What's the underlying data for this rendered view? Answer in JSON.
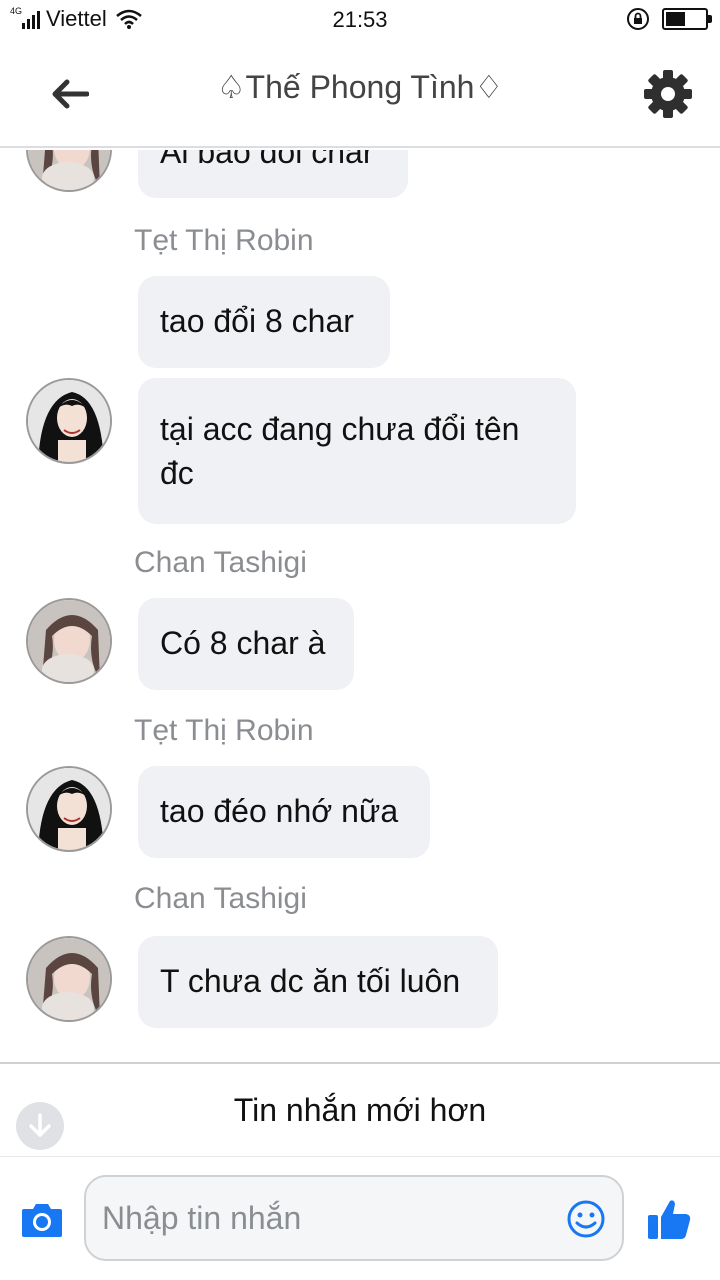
{
  "status_bar": {
    "network": "4G",
    "carrier": "Viettel",
    "time": "21:53",
    "battery_level": 0.5
  },
  "header": {
    "title": "♤Thế Phong Tình♢"
  },
  "messages": {
    "partial_bubble_text": "Ai bảo đổi char",
    "group1_sender": "Tẹt Thị Robin",
    "group1_bubble1": "tao đổi 8 char",
    "group1_bubble2": "tại acc đang chưa đổi tên đc",
    "group2_sender": "Chan Tashigi",
    "group2_bubble1": "Có 8 char à",
    "group3_sender": "Tẹt Thị Robin",
    "group3_bubble1": "tao đéo nhớ nữa",
    "group4_sender": "Chan Tashigi",
    "group4_bubble1": "T chưa dc ăn tối luôn"
  },
  "newer_bar": {
    "label": "Tin nhắn mới hơn"
  },
  "composer": {
    "placeholder": "Nhập tin nhắn"
  },
  "colors": {
    "accent": "#1877f2",
    "bubble_bg": "#f0f1f4",
    "sender_text": "#8a8d91"
  }
}
